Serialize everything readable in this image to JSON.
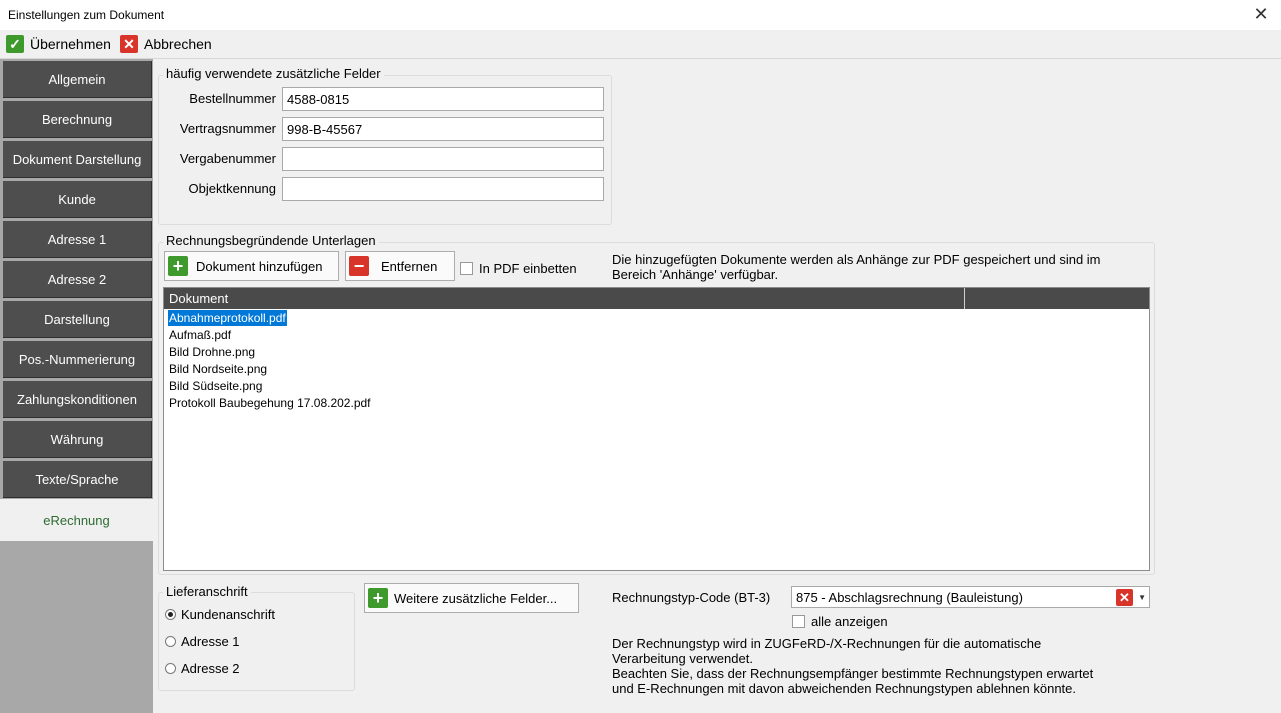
{
  "window": {
    "title": "Einstellungen zum Dokument",
    "close_glyph": "✕"
  },
  "toolbar": {
    "apply_label": "Übernehmen",
    "cancel_label": "Abbrechen",
    "apply_icon": "check-icon",
    "cancel_icon": "x-icon"
  },
  "sidebar": {
    "items": [
      {
        "label": "Allgemein"
      },
      {
        "label": "Berechnung"
      },
      {
        "label": "Dokument Darstellung"
      },
      {
        "label": "Kunde"
      },
      {
        "label": "Adresse 1"
      },
      {
        "label": "Adresse 2"
      },
      {
        "label": "Darstellung"
      },
      {
        "label": "Pos.-Nummerierung"
      },
      {
        "label": "Zahlungskonditionen"
      },
      {
        "label": "Währung"
      },
      {
        "label": "Texte/Sprache"
      },
      {
        "label": "eRechnung"
      }
    ],
    "active_index": 11
  },
  "fields_group": {
    "title": "häufig verwendete zusätzliche Felder",
    "fields": [
      {
        "label": "Bestellnummer",
        "value": "4588-0815"
      },
      {
        "label": "Vertragsnummer",
        "value": "998-B-45567"
      },
      {
        "label": "Vergabenummer",
        "value": ""
      },
      {
        "label": "Objektkennung",
        "value": ""
      }
    ]
  },
  "documents_group": {
    "title": "Rechnungsbegründende Unterlagen",
    "add_button": "Dokument hinzufügen",
    "remove_button": "Entfernen",
    "embed_checkbox": "In PDF einbetten",
    "embed_checked": false,
    "info_line1": "Die hinzugefügten Dokumente werden als Anhänge zur PDF gespeichert und sind im",
    "info_line2": "Bereich 'Anhänge' verfügbar.",
    "table": {
      "header": "Dokument",
      "rows": [
        "Abnahmeprotokoll.pdf",
        "Aufmaß.pdf",
        "Bild Drohne.png",
        "Bild Nordseite.png",
        "Bild Südseite.png",
        "Protokoll Baubegehung 17.08.202.pdf"
      ],
      "selected_index": 0
    }
  },
  "delivery_group": {
    "title": "Lieferanschrift",
    "options": [
      "Kundenanschrift",
      "Adresse 1",
      "Adresse 2"
    ],
    "selected_index": 0
  },
  "more_fields_button": "Weitere zusätzliche Felder...",
  "invoice_type": {
    "label": "Rechnungstyp-Code (BT-3)",
    "value": "875 - Abschlagsrechnung (Bauleistung)",
    "show_all_label": "alle anzeigen",
    "show_all_checked": false,
    "info_line1": "Der Rechnungstyp wird in ZUGFeRD-/X-Rechnungen für die automatische",
    "info_line2": "Verarbeitung verwendet.",
    "info_line3": "Beachten Sie, dass der Rechnungsempfänger bestimmte Rechnungstypen erwartet",
    "info_line4": "und E-Rechnungen mit davon abweichenden Rechnungstypen ablehnen könnte."
  },
  "colors": {
    "sidebar_button": "#4e4e4e",
    "active_text": "#2e6b33",
    "selection": "#0078d7",
    "green_icon": "#3f9a2e",
    "red_icon": "#d8342a"
  }
}
